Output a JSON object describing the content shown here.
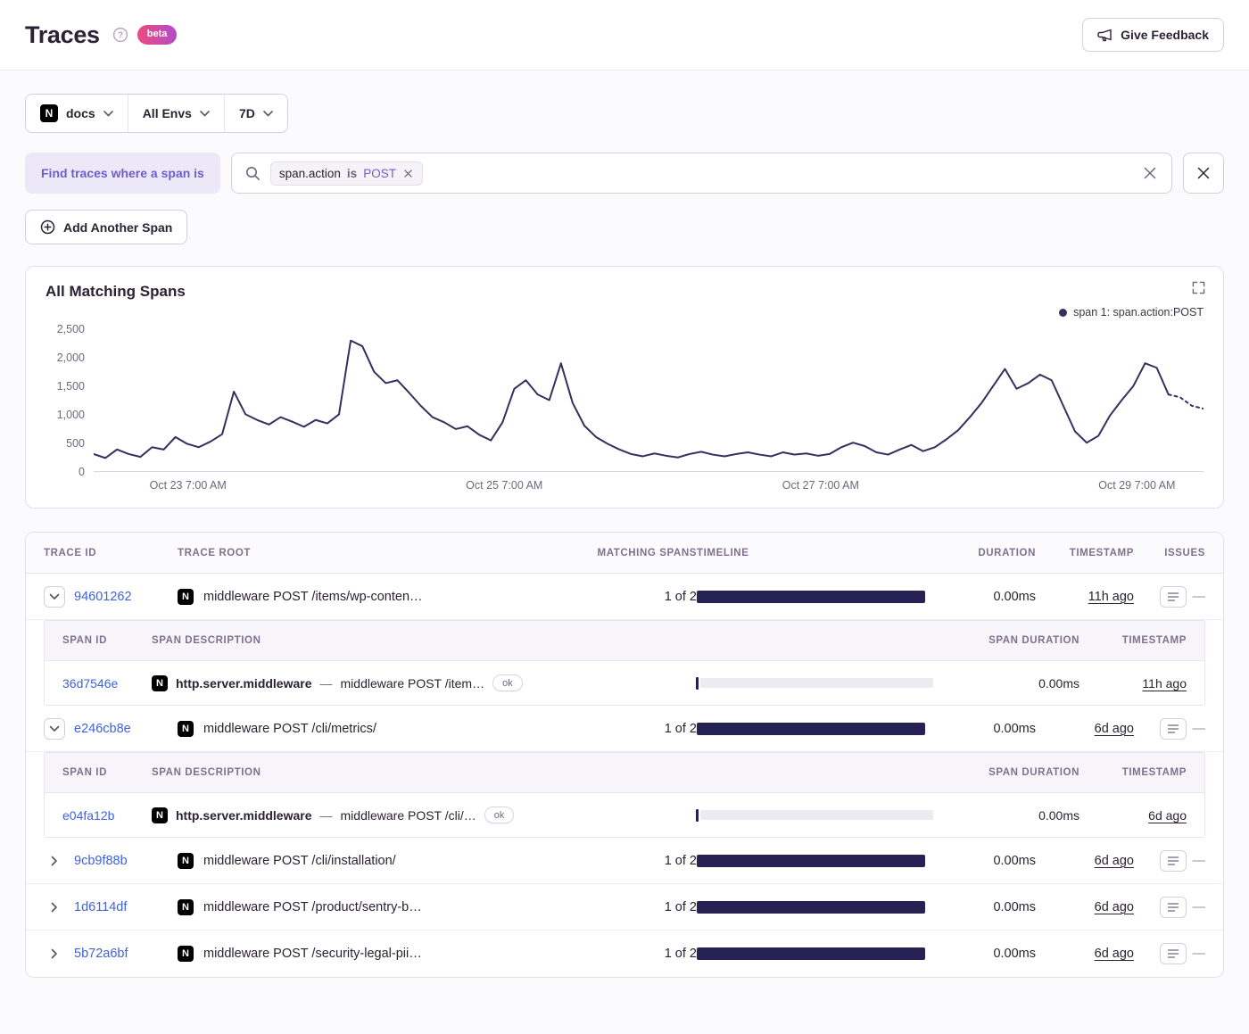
{
  "colors": {
    "accent": "#6d5fc7",
    "accent_bg": "#ece8f8",
    "link": "#3e63dd",
    "bar": "#272254",
    "series": "#33305e",
    "text": "#2b2233",
    "muted": "#71667e",
    "border": "#d4d0da",
    "panel_border": "#e2dfe8",
    "badge_start": "#ee4b7f",
    "badge_end": "#b14cc8"
  },
  "header": {
    "title": "Traces",
    "beta_label": "beta",
    "feedback_label": "Give Feedback"
  },
  "filters": {
    "project_label": "docs",
    "env_label": "All Envs",
    "period_label": "7D",
    "find_label": "Find traces where a span is",
    "token_key": "span.action",
    "token_op": "is",
    "token_value": "POST",
    "add_span_label": "Add Another Span"
  },
  "misc": {
    "project_initial": "N",
    "separator": "—",
    "issues_placeholder": "—"
  },
  "chart": {
    "title": "All Matching Spans",
    "chart_data": {
      "type": "line",
      "title": "All Matching Spans",
      "legend": [
        "span 1: span.action:POST"
      ],
      "legend_position": "top-right",
      "ylim": [
        0,
        2500
      ],
      "y_ticks": [
        "2,500",
        "2,000",
        "1,500",
        "1,000",
        "500",
        "0"
      ],
      "x_ticks": [
        "Oct 23 7:00 AM",
        "Oct 25 7:00 AM",
        "Oct 27 7:00 AM",
        "Oct 29 7:00 AM"
      ],
      "x_tick_pos": [
        0.085,
        0.37,
        0.655,
        0.94
      ],
      "grid": false,
      "dashed_tail_points": 4,
      "series": [
        {
          "name": "span 1: span.action:POST",
          "values": [
            300,
            230,
            380,
            300,
            250,
            420,
            380,
            600,
            480,
            420,
            520,
            650,
            1400,
            1000,
            900,
            820,
            950,
            870,
            780,
            900,
            840,
            1000,
            2300,
            2200,
            1750,
            1550,
            1600,
            1380,
            1150,
            950,
            860,
            740,
            790,
            640,
            540,
            860,
            1450,
            1600,
            1350,
            1250,
            1900,
            1200,
            800,
            600,
            480,
            380,
            300,
            260,
            310,
            270,
            240,
            300,
            340,
            290,
            260,
            300,
            330,
            290,
            260,
            330,
            290,
            310,
            270,
            300,
            420,
            500,
            440,
            330,
            290,
            380,
            460,
            350,
            420,
            560,
            720,
            950,
            1200,
            1500,
            1800,
            1450,
            1550,
            1700,
            1600,
            1150,
            700,
            500,
            620,
            980,
            1250,
            1500,
            1900,
            1820,
            1350,
            1300,
            1150,
            1100
          ]
        }
      ]
    }
  },
  "table": {
    "headers": [
      "TRACE ID",
      "TRACE ROOT",
      "MATCHING SPANS",
      "TIMELINE",
      "DURATION",
      "TIMESTAMP",
      "ISSUES"
    ],
    "sub_headers": [
      "SPAN ID",
      "SPAN DESCRIPTION",
      "SPAN DURATION",
      "TIMESTAMP"
    ],
    "rows": [
      {
        "expanded": true,
        "trace_id": "94601262",
        "root": "middleware POST /items/wp-conten…",
        "matching": "1 of 2",
        "duration": "0.00ms",
        "timestamp": "11h ago",
        "spans": [
          {
            "span_id": "36d7546e",
            "op": "http.server.middleware",
            "desc": "middleware POST /item…",
            "status": "ok",
            "duration": "0.00ms",
            "timestamp": "11h ago"
          }
        ]
      },
      {
        "expanded": true,
        "trace_id": "e246cb8e",
        "root": "middleware POST /cli/metrics/",
        "matching": "1 of 2",
        "duration": "0.00ms",
        "timestamp": "6d ago",
        "spans": [
          {
            "span_id": "e04fa12b",
            "op": "http.server.middleware",
            "desc": "middleware POST /cli/…",
            "status": "ok",
            "duration": "0.00ms",
            "timestamp": "6d ago"
          }
        ]
      },
      {
        "expanded": false,
        "trace_id": "9cb9f88b",
        "root": "middleware POST /cli/installation/",
        "matching": "1 of 2",
        "duration": "0.00ms",
        "timestamp": "6d ago",
        "spans": []
      },
      {
        "expanded": false,
        "trace_id": "1d6114df",
        "root": "middleware POST /product/sentry-b…",
        "matching": "1 of 2",
        "duration": "0.00ms",
        "timestamp": "6d ago",
        "spans": []
      },
      {
        "expanded": false,
        "trace_id": "5b72a6bf",
        "root": "middleware POST /security-legal-pii…",
        "matching": "1 of 2",
        "duration": "0.00ms",
        "timestamp": "6d ago",
        "spans": []
      }
    ]
  }
}
